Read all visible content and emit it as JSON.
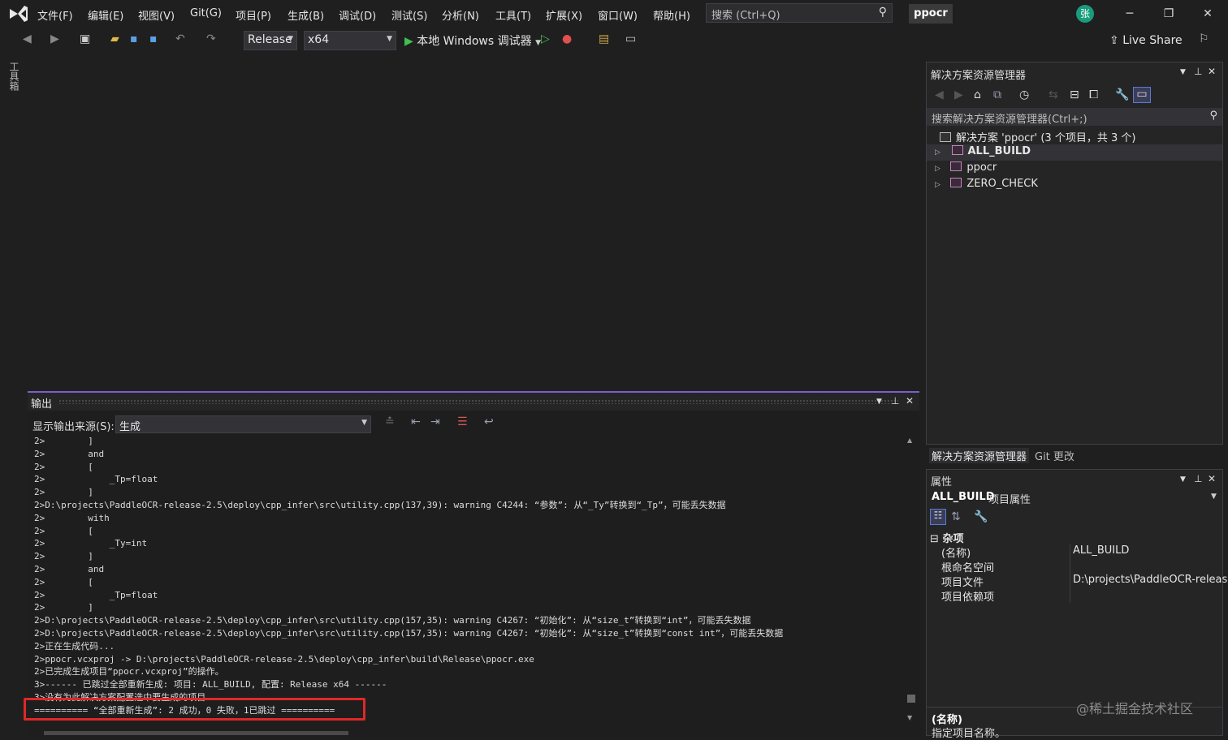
{
  "menubar": {
    "items": [
      "文件(F)",
      "编辑(E)",
      "视图(V)",
      "Git(G)",
      "项目(P)",
      "生成(B)",
      "调试(D)",
      "测试(S)",
      "分析(N)",
      "工具(T)",
      "扩展(X)",
      "窗口(W)",
      "帮助(H)"
    ],
    "search_placeholder": "搜索 (Ctrl+Q)",
    "project_name": "ppocr",
    "avatar_initial": "张"
  },
  "toolbar": {
    "config": "Release",
    "platform": "x64",
    "run_label": "本地 Windows 调试器",
    "live_share": "Live Share"
  },
  "side": {
    "toolbox_label": "工具箱"
  },
  "output": {
    "title": "输出",
    "source_label": "显示输出来源(S):",
    "source_value": "生成",
    "lines": [
      "2>        ]",
      "2>        and",
      "2>        [",
      "2>            _Tp=float",
      "2>        ]",
      "2>D:\\projects\\PaddleOCR-release-2.5\\deploy\\cpp_infer\\src\\utility.cpp(137,39): warning C4244: “参数”: 从“_Ty”转换到“_Tp”，可能丢失数据",
      "2>        with",
      "2>        [",
      "2>            _Ty=int",
      "2>        ]",
      "2>        and",
      "2>        [",
      "2>            _Tp=float",
      "2>        ]",
      "2>D:\\projects\\PaddleOCR-release-2.5\\deploy\\cpp_infer\\src\\utility.cpp(157,35): warning C4267: “初始化”: 从“size_t”转换到“int”，可能丢失数据",
      "2>D:\\projects\\PaddleOCR-release-2.5\\deploy\\cpp_infer\\src\\utility.cpp(157,35): warning C4267: “初始化”: 从“size_t”转换到“const int”，可能丢失数据",
      "2>正在生成代码...",
      "2>ppocr.vcxproj -> D:\\projects\\PaddleOCR-release-2.5\\deploy\\cpp_infer\\build\\Release\\ppocr.exe",
      "2>已完成生成项目“ppocr.vcxproj”的操作。",
      "3>------ 已跳过全部重新生成: 项目: ALL_BUILD, 配置: Release x64 ------",
      "3>没有为此解决方案配置选中要生成的项目",
      "========== “全部重新生成”: 2 成功，0 失败，1已跳过 =========="
    ]
  },
  "solution": {
    "title": "解决方案资源管理器",
    "search_placeholder": "搜索解决方案资源管理器(Ctrl+;)",
    "root": "解决方案 'ppocr' (3 个项目，共 3 个)",
    "projects": [
      "ALL_BUILD",
      "ppocr",
      "ZERO_CHECK"
    ],
    "tabs": [
      "解决方案资源管理器",
      "Git 更改"
    ]
  },
  "properties": {
    "title": "属性",
    "object_name": "ALL_BUILD",
    "object_type": "项目属性",
    "category": "杂项",
    "rows": [
      {
        "key": "(名称)",
        "value": "ALL_BUILD"
      },
      {
        "key": "根命名空间",
        "value": ""
      },
      {
        "key": "项目文件",
        "value": "D:\\projects\\PaddleOCR-release"
      },
      {
        "key": "项目依赖项",
        "value": ""
      }
    ],
    "desc_title": "(名称)",
    "desc_text": "指定项目名称。"
  },
  "watermark": "@稀土掘金技术社区",
  "colors": {
    "accent": "#7a5fd0",
    "highlight_box": "#e02828",
    "run_green": "#3fc050"
  }
}
